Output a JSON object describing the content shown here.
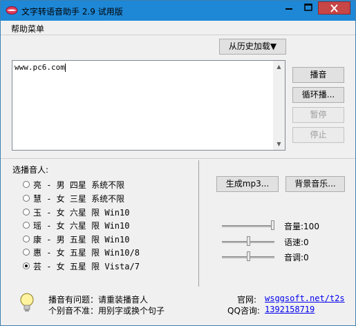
{
  "window": {
    "title": "文字转语音助手 2.9 试用版",
    "controls": {
      "minimize": "▭",
      "maximize": "□",
      "close": "✕"
    }
  },
  "menu": {
    "help": "帮助菜单"
  },
  "history_button": "从历史加载▼",
  "text_input": {
    "value": "www.pc6.com"
  },
  "actions": {
    "play": "播音",
    "loop_play": "循环播...",
    "pause": "暂停",
    "stop": "停止"
  },
  "voice_section": {
    "label": "选播音人:",
    "voices": [
      {
        "text": "亮 - 男 四星 系统不限",
        "selected": false
      },
      {
        "text": "慧 - 女 三星 系统不限",
        "selected": false
      },
      {
        "text": "玉 - 女 六星 限 Win10",
        "selected": false
      },
      {
        "text": "瑶 - 女 六星 限 Win10",
        "selected": false
      },
      {
        "text": "康 - 男 五星 限 Win10",
        "selected": false
      },
      {
        "text": "惠 - 女 五星 限 Win10/8",
        "selected": false
      },
      {
        "text": "芸 - 女 五星 限 Vista/7",
        "selected": true
      }
    ]
  },
  "tools": {
    "mp3": "生成mp3...",
    "bgm": "背景音乐..."
  },
  "sliders": {
    "volume": {
      "label": "音量:100",
      "value": 100,
      "min": 0,
      "max": 100
    },
    "speed": {
      "label": "语速:0",
      "value": 0,
      "min": -10,
      "max": 10
    },
    "pitch": {
      "label": "音调:0",
      "value": 0,
      "min": -10,
      "max": 10
    }
  },
  "footer": {
    "help_line1": "播音有问题：请重装播音人",
    "help_line2": "个别音不准：用别字或换个句子",
    "site_label": "官网:",
    "site_link": "wsggsoft.net/t2s",
    "qq_label": "QQ咨询:",
    "qq_link": "1392158719"
  },
  "colors": {
    "titlebar": "#1e87d6",
    "close_button": "#c74646",
    "link": "#0000ee"
  }
}
